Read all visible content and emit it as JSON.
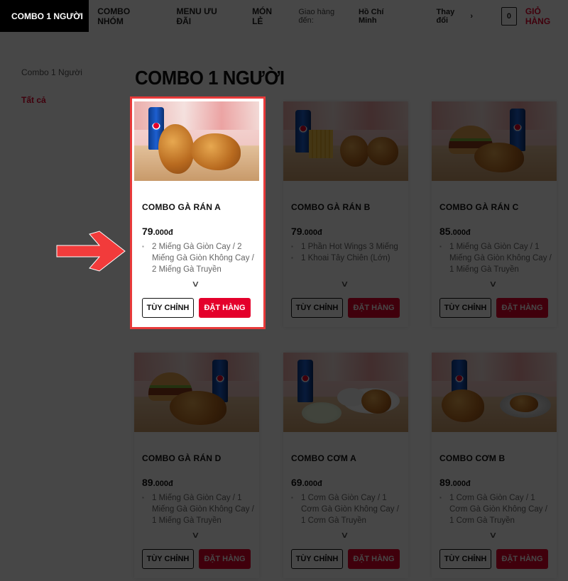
{
  "nav": {
    "items": [
      "COMBO 1 NGƯỜI",
      "COMBO NHÓM",
      "MENU ƯU ĐÃI",
      "MÓN LẺ"
    ],
    "deliver_label": "Giao hàng đến:",
    "city": "Hồ Chí Minh",
    "change_label": "Thay đổi",
    "cart_count": "0",
    "cart_label": "GIỎ HÀNG"
  },
  "sidebar": {
    "items": [
      "Combo 1 Người",
      "Tất cả"
    ]
  },
  "page_title": "COMBO 1 NGƯỜI",
  "buttons": {
    "customize": "TÙY CHỈNH",
    "order": "ĐẶT HÀNG"
  },
  "products": [
    {
      "name": "COMBO GÀ RÁN A",
      "price_main": "79",
      "price_tail": ".000đ",
      "desc": [
        "2 Miếng Gà Giòn Cay / 2 Miếng Gà Giòn Không Cay / 2 Miếng Gà Truyền"
      ]
    },
    {
      "name": "COMBO GÀ RÁN B",
      "price_main": "79",
      "price_tail": ".000đ",
      "desc": [
        "1 Phần Hot Wings 3 Miếng",
        "1 Khoai Tây Chiên (Lớn)"
      ]
    },
    {
      "name": "COMBO GÀ RÁN C",
      "price_main": "85",
      "price_tail": ".000đ",
      "desc": [
        "1 Miếng Gà Giòn Cay / 1 Miếng Gà Giòn Không Cay / 1 Miếng Gà Truyền"
      ]
    },
    {
      "name": "COMBO GÀ RÁN D",
      "price_main": "89",
      "price_tail": ".000đ",
      "desc": [
        "1 Miếng Gà Giòn Cay / 1 Miếng Gà Giòn Không Cay / 1 Miếng Gà Truyền"
      ]
    },
    {
      "name": "COMBO CƠM A",
      "price_main": "69",
      "price_tail": ".000đ",
      "desc": [
        "1 Cơm Gà Giòn Cay / 1 Cơm Gà Giòn Không Cay / 1 Cơm Gà Truyền"
      ]
    },
    {
      "name": "COMBO CƠM B",
      "price_main": "89",
      "price_tail": ".000đ",
      "desc": [
        "1 Cơm Gà Giòn Cay / 1 Cơm Gà Giòn Không Cay / 1 Cơm Gà Truyền"
      ]
    }
  ],
  "colors": {
    "accent": "#e4002b",
    "highlight": "#e83a3a",
    "overlay": "rgba(0,0,0,0.72)"
  }
}
